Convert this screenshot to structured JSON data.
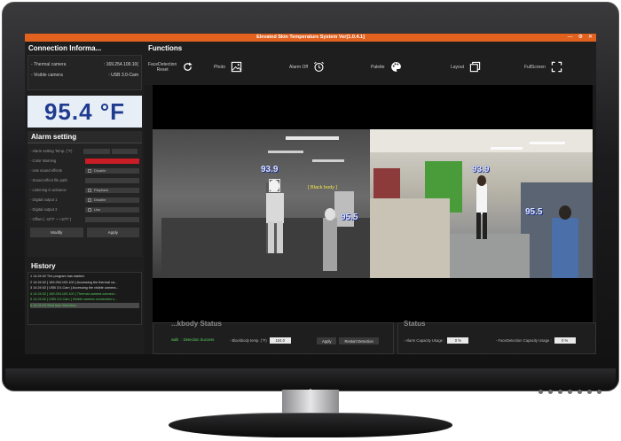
{
  "window": {
    "title": "Elevated Skin Temperature System Ver[1.0.4.1]"
  },
  "connection": {
    "title": "Connection Informa...",
    "thermal_label": "- Thermal camera",
    "thermal_value": ": 169.254.100.10(",
    "visible_label": "- Visible camera",
    "visible_value": ": USB 3.0-Cam"
  },
  "temperature": {
    "display": "95.4 °F"
  },
  "alarm": {
    "title": "Alarm setting",
    "rows": [
      {
        "label": "- Alarm setting Temp. (°F)"
      },
      {
        "label": "- Color Warning"
      },
      {
        "label": "- Use sound effects",
        "control": "Disable"
      },
      {
        "label": "- Sound effect file path"
      },
      {
        "label": "- Listening in advance",
        "control": "Playback"
      },
      {
        "label": "- Digital output 1",
        "control": "Disable"
      },
      {
        "label": "- Digital output 2",
        "control": "Use"
      },
      {
        "label": "- Offset ( -10°F ~ +10°F )"
      }
    ],
    "modify_label": "Modify",
    "apply_label": "Apply"
  },
  "history": {
    "title": "History",
    "entries": [
      {
        "text": "1    14:24:02   The program has started.",
        "style": "normal"
      },
      {
        "text": "2    14:24:02   [ 169.254.100.100 ] Accessing the thermal ca...",
        "style": "normal"
      },
      {
        "text": "3    14:24:02   [ USB 3.0-Cam ] Accessing the visible camera...",
        "style": "normal"
      },
      {
        "text": "4    14:24:02   [ 169.254.100.100 ] Thermal camera connect...",
        "style": "green"
      },
      {
        "text": "5    14:24:02   [ USB 3.0-Cam ] Visible camera connection s...",
        "style": "green"
      },
      {
        "text": "6    14:24:03   Start face detection.",
        "style": "selected"
      }
    ]
  },
  "functions": {
    "title": "Functions",
    "face_detection_label": "FaceDetection",
    "face_reset_label": "Reset",
    "photo_label": "Photo",
    "alarm_off_label": "Alarm Off",
    "palette_label": "Palette",
    "layout_label": "Layout",
    "fullscreen_label": "FullScreen"
  },
  "video": {
    "thermal_tag_1": "93.9",
    "thermal_tag_2": "95.5",
    "blackbody_label": "[ Black body ]",
    "visible_tag_1": "93.9",
    "visible_tag_2": "95.5"
  },
  "status": {
    "left_title": "...kbody Status",
    "detection_prefix": "walk",
    "detection_status": ": Detection Success",
    "blackbody_temp_label": "- Blackbody temp. (°F)",
    "blackbody_temp_value": "104.0",
    "apply_label": "Apply",
    "restart_label": "Restart Detection",
    "right_title": "Status",
    "alarm_capacity_label": "- Alarm Capacity Usage :",
    "alarm_capacity_value": "0 %",
    "face_capacity_label": "- FaceDetection Capacity Usage :",
    "face_capacity_value": "0 %"
  },
  "colors": {
    "title_bar": "#e2611f",
    "temperature_text": "#1f3b8f",
    "color_warning": "#c81d25",
    "success_green": "#59d05a"
  }
}
